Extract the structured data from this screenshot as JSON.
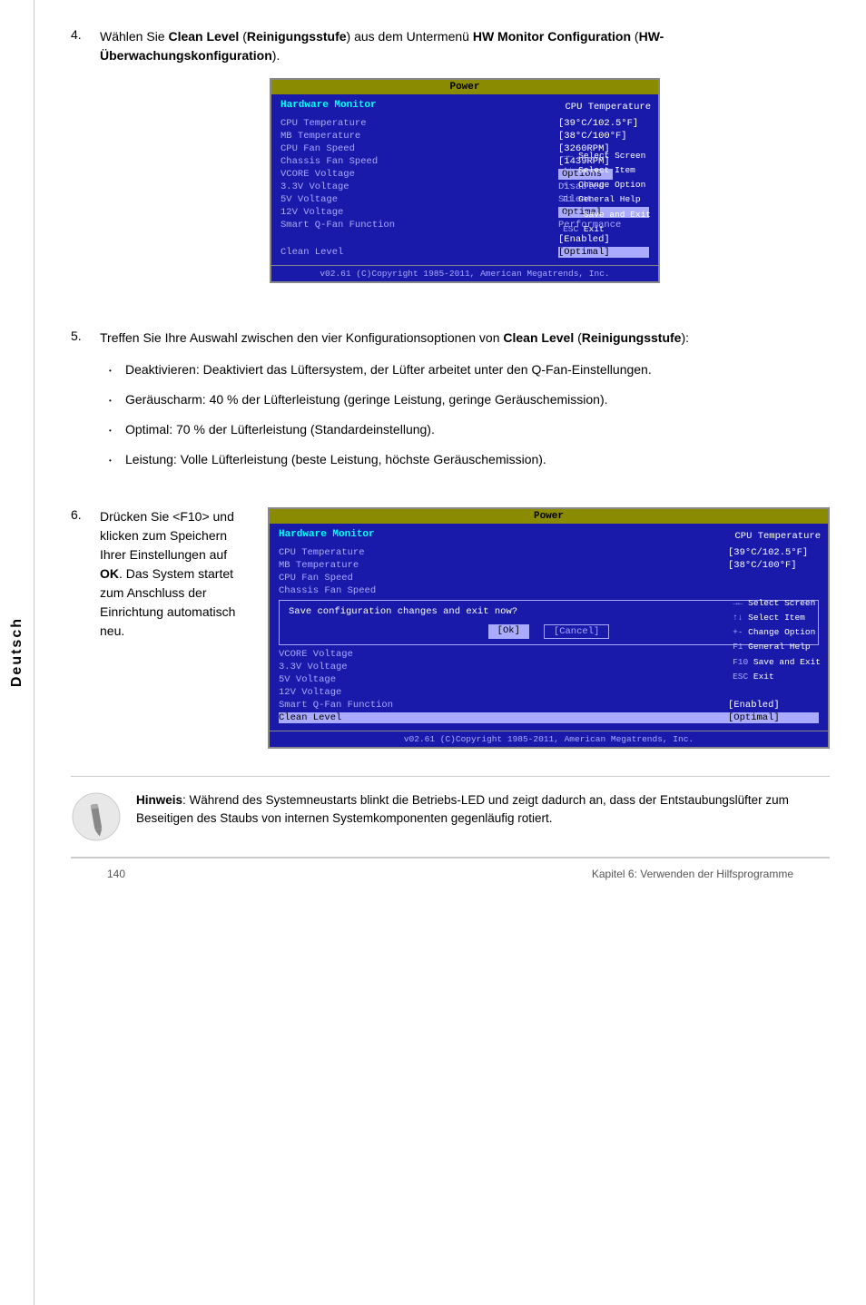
{
  "sidebar": {
    "label": "Deutsch"
  },
  "step4": {
    "number": "4.",
    "text_part1": "Wählen Sie ",
    "bold1": "Clean Level",
    "text_part2": " (",
    "bold2": "Reinigungsstufe",
    "text_part3": ") aus dem Untermenü ",
    "bold3": "HW Monitor Configuration",
    "text_part4": " (",
    "bold4": "HW-Überwachungskonfiguration",
    "text_part5": ")."
  },
  "step5": {
    "number": "5.",
    "text_part1": "Treffen Sie Ihre Auswahl zwischen den vier Konfigurationsoptionen von ",
    "bold1": "Clean Level",
    "text_part2": " (",
    "bold2": "Reinigungsstufe",
    "text_part3": "):",
    "bullets": [
      "Deaktivieren: Deaktiviert das Lüftersystem, der Lüfter arbeitet unter den Q-Fan-Einstellungen.",
      "Geräuscharm: 40 % der Lüfterleistung (geringe Leistung, geringe Geräuschemission).",
      "Optimal: 70 % der Lüfterleistung (Standardeinstellung).",
      "Leistung: Volle Lüfterleistung (beste Leistung, höchste Geräuschemission)."
    ]
  },
  "step6": {
    "number": "6.",
    "text_intro": "Drücken Sie <F10> und klicken zum Speichern Ihrer Einstellungen auf ",
    "bold1": "OK",
    "text_after": ". Das System startet zum Anschluss der Einrichtung automatisch neu."
  },
  "bios1": {
    "title": "Power",
    "header": "Hardware Monitor",
    "right_title": "CPU Temperature",
    "rows": [
      {
        "label": "CPU Temperature",
        "value": "[39°C/102.5°F]"
      },
      {
        "label": "MB Temperature",
        "value": "[38°C/100°F]"
      },
      {
        "label": "CPU Fan Speed",
        "value": "[3260RPM]"
      },
      {
        "label": "Chassis Fan Speed",
        "value": "[1439RPM]"
      },
      {
        "label": "VCORE Voltage",
        "value": ""
      },
      {
        "label": "3.3V Voltage",
        "value": ""
      },
      {
        "label": "5V Voltage",
        "value": ""
      },
      {
        "label": "12V Voltage",
        "value": ""
      }
    ],
    "options_title": "Options",
    "options": [
      {
        "text": "Disabled",
        "selected": false
      },
      {
        "text": "Silent",
        "selected": false
      },
      {
        "text": "Optimal",
        "selected": true
      },
      {
        "text": "Performance",
        "selected": false
      }
    ],
    "smart_label": "Smart Q-Fan Function",
    "smart_value": "[Enabled]",
    "clean_label": "Clean Level",
    "clean_value": "[Optimal]",
    "keys": [
      {
        "key": "→←",
        "desc": "Select Screen"
      },
      {
        "key": "↑↓",
        "desc": "Select Item"
      },
      {
        "key": "+-",
        "desc": "Change Option"
      },
      {
        "key": "F1",
        "desc": "General Help"
      },
      {
        "key": "F10",
        "desc": "Save and Exit"
      },
      {
        "key": "ESC",
        "desc": "Exit"
      }
    ],
    "footer": "v02.61 (C)Copyright 1985-2011, American Megatrends, Inc."
  },
  "bios2": {
    "title": "Power",
    "header": "Hardware Monitor",
    "right_title": "CPU Temperature",
    "rows": [
      {
        "label": "CPU Temperature",
        "value": "[39°C/102.5°F]"
      },
      {
        "label": "MB Temperature",
        "value": "[38°C/100°F]"
      },
      {
        "label": "CPU Fan Speed",
        "value": ""
      },
      {
        "label": "Chassis Fan Speed",
        "value": ""
      }
    ],
    "dialog_text": "Save configuration changes and exit now?",
    "ok_label": "[Ok]",
    "cancel_label": "[Cancel]",
    "vcore_label": "VCORE Voltage",
    "v33_label": "3.3V Voltage",
    "v5_label": "5V Voltage",
    "v12_label": "12V Voltage",
    "smart_label": "Smart Q-Fan Function",
    "smart_value": "[Enabled]",
    "clean_label": "Clean Level",
    "clean_value": "[Optimal]",
    "keys": [
      {
        "key": "→←",
        "desc": "Select Screen"
      },
      {
        "key": "↑↓",
        "desc": "Select Item"
      },
      {
        "key": "+-",
        "desc": "Change Option"
      },
      {
        "key": "F1",
        "desc": "General Help"
      },
      {
        "key": "F10",
        "desc": "Save and Exit"
      },
      {
        "key": "ESC",
        "desc": "Exit"
      }
    ],
    "footer": "v02.61 (C)Copyright 1985-2011, American Megatrends, Inc."
  },
  "note": {
    "text_bold": "Hinweis",
    "text": ": Während des Systemneustarts blinkt die Betriebs-LED und zeigt dadurch an, dass der Entstaubungslüfter zum Beseitigen des Staubs von internen Systemkomponenten gegenläufig rotiert."
  },
  "footer": {
    "page_number": "140",
    "chapter": "Kapitel 6: Verwenden der Hilfsprogramme"
  }
}
